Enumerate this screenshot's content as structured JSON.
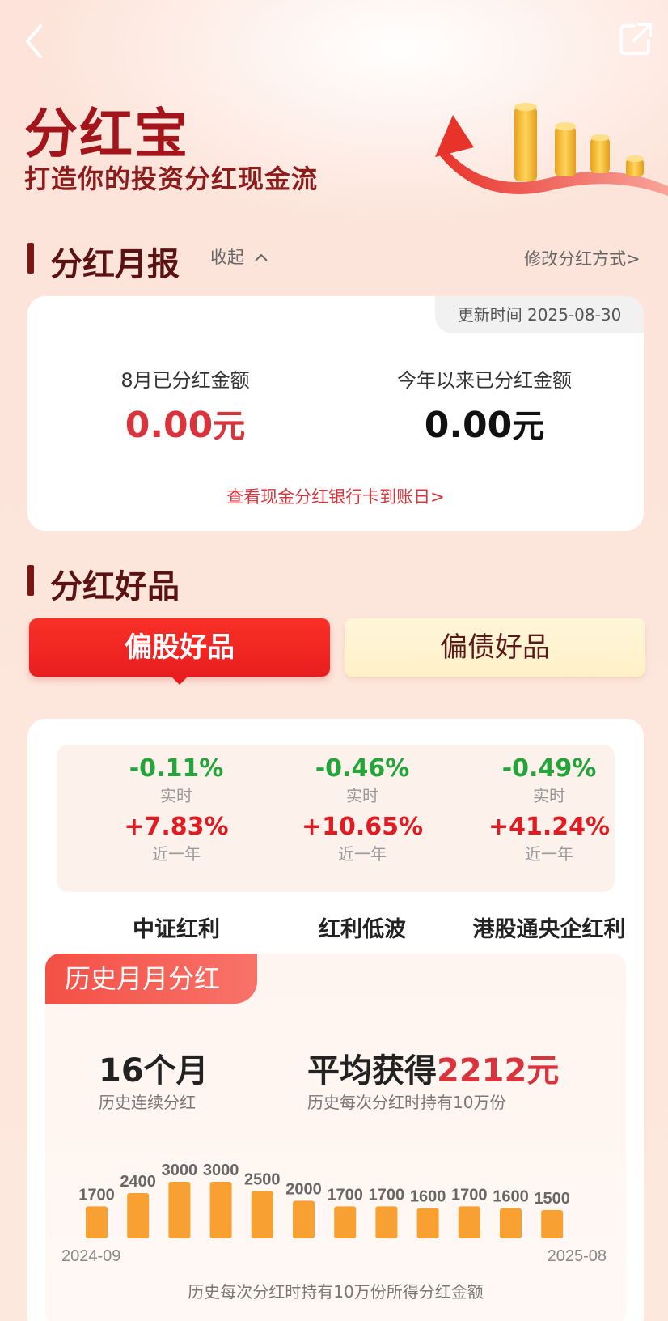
{
  "header": {
    "back_icon": "chevron-left-icon",
    "share_icon": "share-icon"
  },
  "hero": {
    "title": "分红宝",
    "subtitle": "打造你的投资分红现金流"
  },
  "monthly_report": {
    "title": "分红月报",
    "collapse_label": "收起",
    "modify_label": "修改分红方式>",
    "update_time": "更新时间 2025-08-30",
    "month_label": "8月已分红金额",
    "month_value": "0.00",
    "year_label": "今年以来已分红金额",
    "year_value": "0.00",
    "unit": "元",
    "bank_link": "查看现金分红银行卡到账日>"
  },
  "goods": {
    "title": "分红好品",
    "tabs": [
      {
        "label": "偏股好品",
        "active": true
      },
      {
        "label": "偏债好品",
        "active": false
      }
    ],
    "indices": [
      {
        "name": "中证红利",
        "realtime": "-0.11%",
        "realtime_label": "实时",
        "year": "+7.83%",
        "year_label": "近一年"
      },
      {
        "name": "红利低波",
        "realtime": "-0.46%",
        "realtime_label": "实时",
        "year": "+10.65%",
        "year_label": "近一年"
      },
      {
        "name": "港股通央企红利",
        "realtime": "-0.49%",
        "realtime_label": "实时",
        "year": "+41.24%",
        "year_label": "近一年"
      }
    ]
  },
  "history": {
    "tag": "历史月月分红",
    "months_value": "16个月",
    "months_note": "历史连续分红",
    "avg_prefix": "平均获得",
    "avg_value": "2212元",
    "avg_note": "历史每次分红时持有10万份",
    "caption": "历史每次分红时持有10万份所得分红金额"
  },
  "chart_data": {
    "type": "bar",
    "categories": [
      "2024-09",
      "2024-10",
      "2024-11",
      "2024-12",
      "2025-01",
      "2025-02",
      "2025-03",
      "2025-04",
      "2025-05",
      "2025-06",
      "2025-07",
      "2025-08"
    ],
    "values": [
      1700,
      2400,
      3000,
      3000,
      2500,
      2000,
      1700,
      1700,
      1600,
      1700,
      1600,
      1500
    ],
    "x_start_label": "2024-09",
    "x_end_label": "2025-08",
    "title": "",
    "xlabel": "",
    "ylabel": "",
    "ylim": [
      0,
      3000
    ],
    "bar_color": "#f9a032"
  }
}
